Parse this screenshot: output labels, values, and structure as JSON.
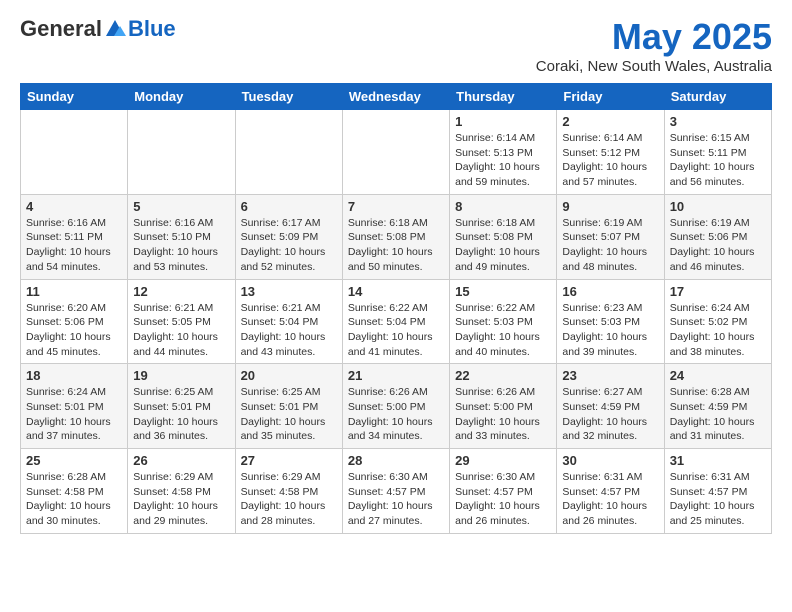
{
  "logo": {
    "general": "General",
    "blue": "Blue"
  },
  "header": {
    "month": "May 2025",
    "location": "Coraki, New South Wales, Australia"
  },
  "weekdays": [
    "Sunday",
    "Monday",
    "Tuesday",
    "Wednesday",
    "Thursday",
    "Friday",
    "Saturday"
  ],
  "weeks": [
    [
      {
        "day": "",
        "info": ""
      },
      {
        "day": "",
        "info": ""
      },
      {
        "day": "",
        "info": ""
      },
      {
        "day": "",
        "info": ""
      },
      {
        "day": "1",
        "info": "Sunrise: 6:14 AM\nSunset: 5:13 PM\nDaylight: 10 hours and 59 minutes."
      },
      {
        "day": "2",
        "info": "Sunrise: 6:14 AM\nSunset: 5:12 PM\nDaylight: 10 hours and 57 minutes."
      },
      {
        "day": "3",
        "info": "Sunrise: 6:15 AM\nSunset: 5:11 PM\nDaylight: 10 hours and 56 minutes."
      }
    ],
    [
      {
        "day": "4",
        "info": "Sunrise: 6:16 AM\nSunset: 5:11 PM\nDaylight: 10 hours and 54 minutes."
      },
      {
        "day": "5",
        "info": "Sunrise: 6:16 AM\nSunset: 5:10 PM\nDaylight: 10 hours and 53 minutes."
      },
      {
        "day": "6",
        "info": "Sunrise: 6:17 AM\nSunset: 5:09 PM\nDaylight: 10 hours and 52 minutes."
      },
      {
        "day": "7",
        "info": "Sunrise: 6:18 AM\nSunset: 5:08 PM\nDaylight: 10 hours and 50 minutes."
      },
      {
        "day": "8",
        "info": "Sunrise: 6:18 AM\nSunset: 5:08 PM\nDaylight: 10 hours and 49 minutes."
      },
      {
        "day": "9",
        "info": "Sunrise: 6:19 AM\nSunset: 5:07 PM\nDaylight: 10 hours and 48 minutes."
      },
      {
        "day": "10",
        "info": "Sunrise: 6:19 AM\nSunset: 5:06 PM\nDaylight: 10 hours and 46 minutes."
      }
    ],
    [
      {
        "day": "11",
        "info": "Sunrise: 6:20 AM\nSunset: 5:06 PM\nDaylight: 10 hours and 45 minutes."
      },
      {
        "day": "12",
        "info": "Sunrise: 6:21 AM\nSunset: 5:05 PM\nDaylight: 10 hours and 44 minutes."
      },
      {
        "day": "13",
        "info": "Sunrise: 6:21 AM\nSunset: 5:04 PM\nDaylight: 10 hours and 43 minutes."
      },
      {
        "day": "14",
        "info": "Sunrise: 6:22 AM\nSunset: 5:04 PM\nDaylight: 10 hours and 41 minutes."
      },
      {
        "day": "15",
        "info": "Sunrise: 6:22 AM\nSunset: 5:03 PM\nDaylight: 10 hours and 40 minutes."
      },
      {
        "day": "16",
        "info": "Sunrise: 6:23 AM\nSunset: 5:03 PM\nDaylight: 10 hours and 39 minutes."
      },
      {
        "day": "17",
        "info": "Sunrise: 6:24 AM\nSunset: 5:02 PM\nDaylight: 10 hours and 38 minutes."
      }
    ],
    [
      {
        "day": "18",
        "info": "Sunrise: 6:24 AM\nSunset: 5:01 PM\nDaylight: 10 hours and 37 minutes."
      },
      {
        "day": "19",
        "info": "Sunrise: 6:25 AM\nSunset: 5:01 PM\nDaylight: 10 hours and 36 minutes."
      },
      {
        "day": "20",
        "info": "Sunrise: 6:25 AM\nSunset: 5:01 PM\nDaylight: 10 hours and 35 minutes."
      },
      {
        "day": "21",
        "info": "Sunrise: 6:26 AM\nSunset: 5:00 PM\nDaylight: 10 hours and 34 minutes."
      },
      {
        "day": "22",
        "info": "Sunrise: 6:26 AM\nSunset: 5:00 PM\nDaylight: 10 hours and 33 minutes."
      },
      {
        "day": "23",
        "info": "Sunrise: 6:27 AM\nSunset: 4:59 PM\nDaylight: 10 hours and 32 minutes."
      },
      {
        "day": "24",
        "info": "Sunrise: 6:28 AM\nSunset: 4:59 PM\nDaylight: 10 hours and 31 minutes."
      }
    ],
    [
      {
        "day": "25",
        "info": "Sunrise: 6:28 AM\nSunset: 4:58 PM\nDaylight: 10 hours and 30 minutes."
      },
      {
        "day": "26",
        "info": "Sunrise: 6:29 AM\nSunset: 4:58 PM\nDaylight: 10 hours and 29 minutes."
      },
      {
        "day": "27",
        "info": "Sunrise: 6:29 AM\nSunset: 4:58 PM\nDaylight: 10 hours and 28 minutes."
      },
      {
        "day": "28",
        "info": "Sunrise: 6:30 AM\nSunset: 4:57 PM\nDaylight: 10 hours and 27 minutes."
      },
      {
        "day": "29",
        "info": "Sunrise: 6:30 AM\nSunset: 4:57 PM\nDaylight: 10 hours and 26 minutes."
      },
      {
        "day": "30",
        "info": "Sunrise: 6:31 AM\nSunset: 4:57 PM\nDaylight: 10 hours and 26 minutes."
      },
      {
        "day": "31",
        "info": "Sunrise: 6:31 AM\nSunset: 4:57 PM\nDaylight: 10 hours and 25 minutes."
      }
    ]
  ]
}
